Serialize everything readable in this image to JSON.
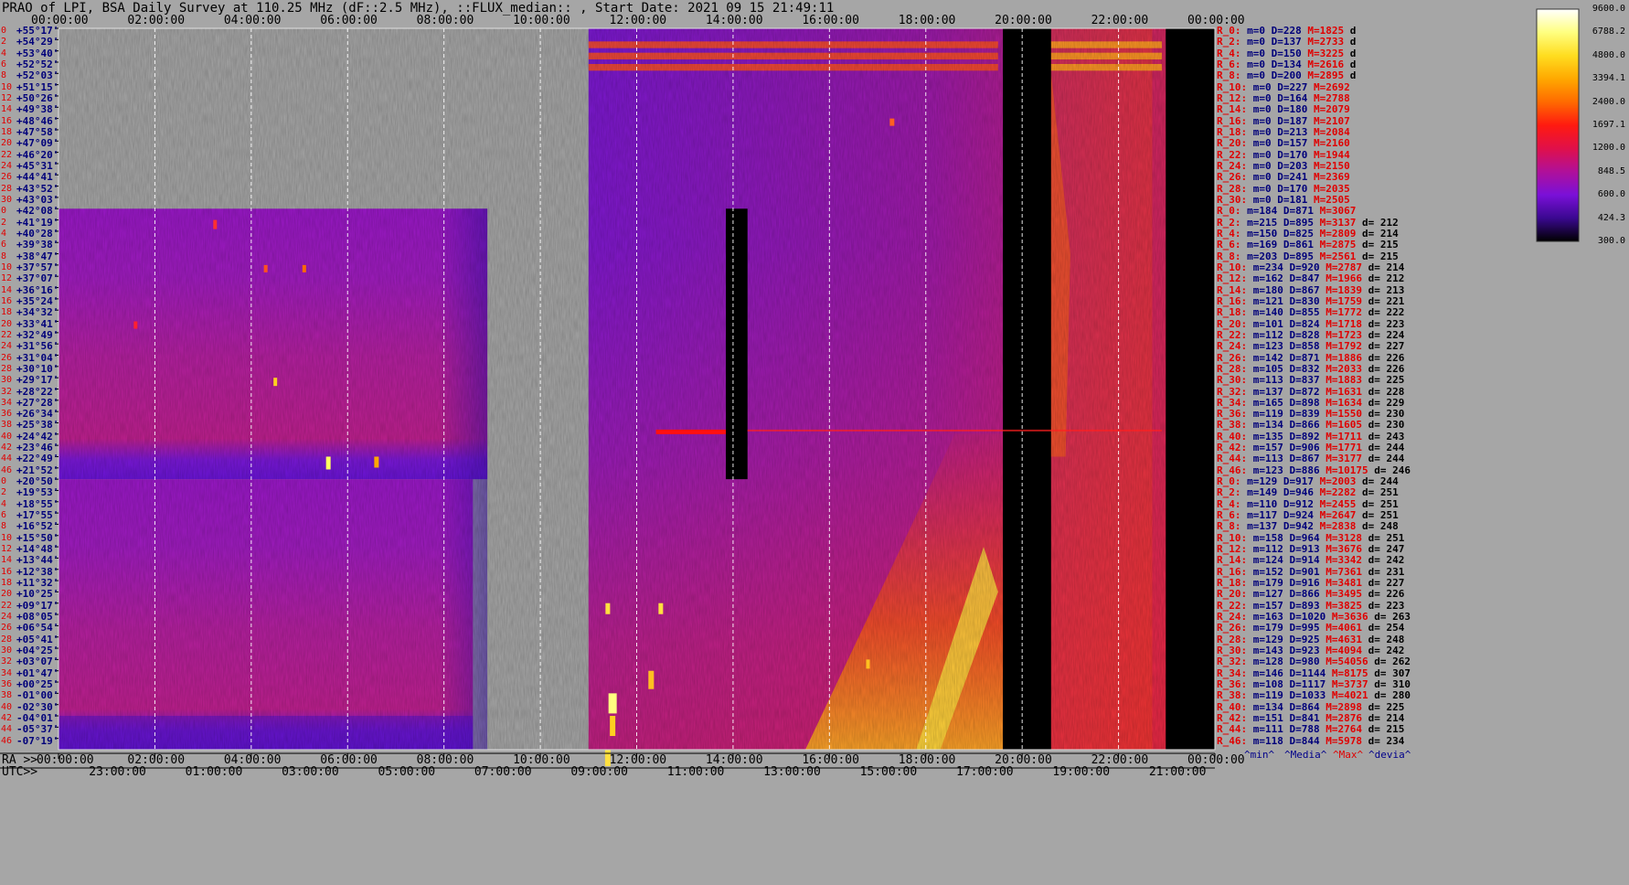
{
  "title": "PRAO of LPI, BSA Daily Survey at 110.25 MHz (dF::2.5 MHz), ::FLUX_median:: , Start Date: 2021 09 15 21:49:11",
  "axis_prefix": {
    "ra": "RA >>",
    "utc": "UTC>>"
  },
  "stats_footer": {
    "min": "^min^",
    "median": "^Media^",
    "max": "^Max^",
    "devia": "^devia^"
  },
  "chart_data": {
    "type": "heatmap",
    "title": "PRAO of LPI, BSA Daily Survey at 110.25 MHz (dF::2.5 MHz), ::FLUX_median:: , Start Date: 2021 09 15 21:49:11",
    "x_top_ticks": [
      "00:00:00",
      "02:00:00",
      "04:00:00",
      "06:00:00",
      "08:00:00",
      "10:00:00",
      "12:00:00",
      "14:00:00",
      "16:00:00",
      "18:00:00",
      "20:00:00",
      "22:00:00",
      "00:00:00"
    ],
    "x_bottom_ra_ticks": [
      "00:00:00",
      "02:00:00",
      "04:00:00",
      "06:00:00",
      "08:00:00",
      "10:00:00",
      "12:00:00",
      "14:00:00",
      "16:00:00",
      "18:00:00",
      "20:00:00",
      "22:00:00",
      "00:00:00"
    ],
    "x_bottom_utc_ticks": [
      "23:00:00",
      "01:00:00",
      "03:00:00",
      "05:00:00",
      "07:00:00",
      "09:00:00",
      "11:00:00",
      "13:00:00",
      "15:00:00",
      "17:00:00",
      "19:00:00",
      "21:00:00"
    ],
    "colorbar": {
      "ticks": [
        "9600.0",
        "6788.2",
        "4800.0",
        "3394.1",
        "2400.0",
        "1697.1",
        "1200.0",
        "848.5",
        "600.0",
        "424.3",
        "300.0"
      ],
      "colors": [
        "#ffffff",
        "#ffff80",
        "#ffdd20",
        "#ffa800",
        "#ff6a00",
        "#ff1a10",
        "#e0104a",
        "#b0109a",
        "#7a10d8",
        "#3a0890",
        "#000000"
      ]
    },
    "rows": [
      {
        "idx": "0",
        "dec": "+55°17'",
        "stats": "R_0: m=0 D=228 M=1825 d"
      },
      {
        "idx": "2",
        "dec": "+54°29'",
        "stats": "R_2: m=0 D=137 M=2733 d"
      },
      {
        "idx": "4",
        "dec": "+53°40'",
        "stats": "R_4: m=0 D=150 M=3225 d"
      },
      {
        "idx": "6",
        "dec": "+52°52'",
        "stats": "R_6: m=0 D=134 M=2616 d"
      },
      {
        "idx": "8",
        "dec": "+52°03'",
        "stats": "R_8: m=0 D=200 M=2895 d"
      },
      {
        "idx": "10",
        "dec": "+51°15'",
        "stats": "R_10: m=0 D=227 M=2692"
      },
      {
        "idx": "12",
        "dec": "+50°26'",
        "stats": "R_12: m=0 D=164 M=2788"
      },
      {
        "idx": "14",
        "dec": "+49°38'",
        "stats": "R_14: m=0 D=180 M=2079"
      },
      {
        "idx": "16",
        "dec": "+48°46'",
        "stats": "R_16: m=0 D=187 M=2107"
      },
      {
        "idx": "18",
        "dec": "+47°58'",
        "stats": "R_18: m=0 D=213 M=2084"
      },
      {
        "idx": "20",
        "dec": "+47°09'",
        "stats": "R_20: m=0 D=157 M=2160"
      },
      {
        "idx": "22",
        "dec": "+46°20'",
        "stats": "R_22: m=0 D=170 M=1944"
      },
      {
        "idx": "24",
        "dec": "+45°31'",
        "stats": "R_24: m=0 D=203 M=2150"
      },
      {
        "idx": "26",
        "dec": "+44°41'",
        "stats": "R_26: m=0 D=241 M=2369"
      },
      {
        "idx": "28",
        "dec": "+43°52'",
        "stats": "R_28: m=0 D=170 M=2035"
      },
      {
        "idx": "30",
        "dec": "+43°03'",
        "stats": "R_30: m=0 D=181 M=2505"
      },
      {
        "idx": "0",
        "dec": "+42°08'",
        "stats": "R_0: m=184 D=871 M=3067"
      },
      {
        "idx": "2",
        "dec": "+41°19'",
        "stats": "R_2: m=215 D=895 M=3137 d= 212"
      },
      {
        "idx": "4",
        "dec": "+40°28'",
        "stats": "R_4: m=150 D=825 M=2809 d= 214"
      },
      {
        "idx": "6",
        "dec": "+39°38'",
        "stats": "R_6: m=169 D=861 M=2875 d= 215"
      },
      {
        "idx": "8",
        "dec": "+38°47'",
        "stats": "R_8: m=203 D=895 M=2561 d= 215"
      },
      {
        "idx": "10",
        "dec": "+37°57'",
        "stats": "R_10: m=234 D=920 M=2787 d= 214"
      },
      {
        "idx": "12",
        "dec": "+37°07'",
        "stats": "R_12: m=162 D=847 M=1966 d= 212"
      },
      {
        "idx": "14",
        "dec": "+36°16'",
        "stats": "R_14: m=180 D=867 M=1839 d= 213"
      },
      {
        "idx": "16",
        "dec": "+35°24'",
        "stats": "R_16: m=121 D=830 M=1759 d= 221"
      },
      {
        "idx": "18",
        "dec": "+34°32'",
        "stats": "R_18: m=140 D=855 M=1772 d= 222"
      },
      {
        "idx": "20",
        "dec": "+33°41'",
        "stats": "R_20: m=101 D=824 M=1718 d= 223"
      },
      {
        "idx": "22",
        "dec": "+32°49'",
        "stats": "R_22: m=112 D=828 M=1723 d= 224"
      },
      {
        "idx": "24",
        "dec": "+31°56'",
        "stats": "R_24: m=123 D=858 M=1792 d= 227"
      },
      {
        "idx": "26",
        "dec": "+31°04'",
        "stats": "R_26: m=142 D=871 M=1886 d= 226"
      },
      {
        "idx": "28",
        "dec": "+30°10'",
        "stats": "R_28: m=105 D=832 M=2033 d= 226"
      },
      {
        "idx": "30",
        "dec": "+29°17'",
        "stats": "R_30: m=113 D=837 M=1883 d= 225"
      },
      {
        "idx": "32",
        "dec": "+28°22'",
        "stats": "R_32: m=137 D=872 M=1631 d= 228"
      },
      {
        "idx": "34",
        "dec": "+27°28'",
        "stats": "R_34: m=165 D=898 M=1634 d= 229"
      },
      {
        "idx": "36",
        "dec": "+26°34'",
        "stats": "R_36: m=119 D=839 M=1550 d= 230"
      },
      {
        "idx": "38",
        "dec": "+25°38'",
        "stats": "R_38: m=134 D=866 M=1605 d= 230"
      },
      {
        "idx": "40",
        "dec": "+24°42'",
        "stats": "R_40: m=135 D=892 M=1711 d= 243"
      },
      {
        "idx": "42",
        "dec": "+23°46'",
        "stats": "R_42: m=157 D=906 M=1771 d= 244"
      },
      {
        "idx": "44",
        "dec": "+22°49'",
        "stats": "R_44: m=113 D=867 M=3177 d= 244"
      },
      {
        "idx": "46",
        "dec": "+21°52'",
        "stats": "R_46: m=123 D=886 M=10175 d= 246"
      },
      {
        "idx": "0",
        "dec": "+20°50'",
        "stats": "R_0: m=129 D=917 M=2003 d= 244"
      },
      {
        "idx": "2",
        "dec": "+19°53'",
        "stats": "R_2: m=149 D=946 M=2282 d= 251"
      },
      {
        "idx": "4",
        "dec": "+18°55'",
        "stats": "R_4: m=110 D=912 M=2455 d= 251"
      },
      {
        "idx": "6",
        "dec": "+17°55'",
        "stats": "R_6: m=117 D=924 M=2647 d= 251"
      },
      {
        "idx": "8",
        "dec": "+16°52'",
        "stats": "R_8: m=137 D=942 M=2838 d= 248"
      },
      {
        "idx": "10",
        "dec": "+15°50'",
        "stats": "R_10: m=158 D=964 M=3128 d= 251"
      },
      {
        "idx": "12",
        "dec": "+14°48'",
        "stats": "R_12: m=112 D=913 M=3676 d= 247"
      },
      {
        "idx": "14",
        "dec": "+13°44'",
        "stats": "R_14: m=124 D=914 M=3342 d= 242"
      },
      {
        "idx": "16",
        "dec": "+12°38'",
        "stats": "R_16: m=152 D=901 M=7361 d= 231"
      },
      {
        "idx": "18",
        "dec": "+11°32'",
        "stats": "R_18: m=179 D=916 M=3481 d= 227"
      },
      {
        "idx": "20",
        "dec": "+10°25'",
        "stats": "R_20: m=127 D=866 M=3495 d= 226"
      },
      {
        "idx": "22",
        "dec": "+09°17'",
        "stats": "R_22: m=157 D=893 M=3825 d= 223"
      },
      {
        "idx": "24",
        "dec": "+08°05'",
        "stats": "R_24: m=163 D=1020 M=3636 d= 263"
      },
      {
        "idx": "26",
        "dec": "+06°54'",
        "stats": "R_26: m=179 D=995 M=4061 d= 254"
      },
      {
        "idx": "28",
        "dec": "+05°41'",
        "stats": "R_28: m=129 D=925 M=4631 d= 248"
      },
      {
        "idx": "30",
        "dec": "+04°25'",
        "stats": "R_30: m=143 D=923 M=4094 d= 242"
      },
      {
        "idx": "32",
        "dec": "+03°07'",
        "stats": "R_32: m=128 D=980 M=54056 d= 262"
      },
      {
        "idx": "34",
        "dec": "+01°47'",
        "stats": "R_34: m=146 D=1144 M=8175 d= 307"
      },
      {
        "idx": "36",
        "dec": "+00°25'",
        "stats": "R_36: m=108 D=1117 M=3737 d= 310"
      },
      {
        "idx": "38",
        "dec": "-01°00'",
        "stats": "R_38: m=119 D=1033 M=4021 d= 280"
      },
      {
        "idx": "40",
        "dec": "-02°30'",
        "stats": "R_40: m=134 D=864 M=2898 d= 225"
      },
      {
        "idx": "42",
        "dec": "-04°01'",
        "stats": "R_42: m=151 D=841 M=2876 d= 214"
      },
      {
        "idx": "44",
        "dec": "-05°37'",
        "stats": "R_44: m=111 D=788 M=2764 d= 215"
      },
      {
        "idx": "46",
        "dec": "-07°19'",
        "stats": "R_46: m=118 D=844 M=5978 d= 234"
      }
    ]
  }
}
